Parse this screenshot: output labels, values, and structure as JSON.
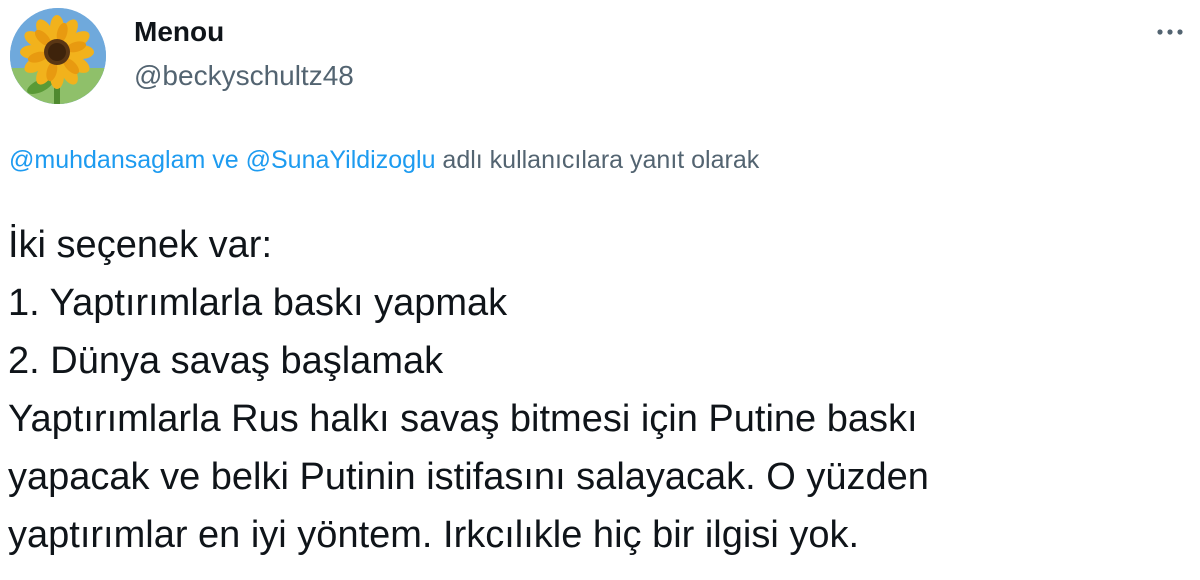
{
  "user": {
    "display_name": "Menou",
    "handle": "@beckyschultz48",
    "avatar_icon": "sunflower-avatar"
  },
  "more_icon": "more-horizontal-icon",
  "reply_context": {
    "mention_1": "@muhdansaglam",
    "connector": " ve ",
    "mention_2": "@SunaYildizoglu",
    "suffix": " adlı kullanıcılara yanıt olarak"
  },
  "tweet": {
    "lines": [
      "İki seçenek var:",
      "1. Yaptırımlarla baskı yapmak",
      "2. Dünya savaş başlamak",
      "Yaptırımlarla Rus halkı savaş bitmesi için Putine baskı",
      "yapacak ve belki Putinin istifasını salayacak. O yüzden",
      "yaptırımlar en iyi yöntem.  Irkcılıkle hiç bir ilgisi yok."
    ]
  },
  "colors": {
    "text": "#0f1419",
    "secondary": "#536471",
    "link": "#1d9bf0"
  }
}
